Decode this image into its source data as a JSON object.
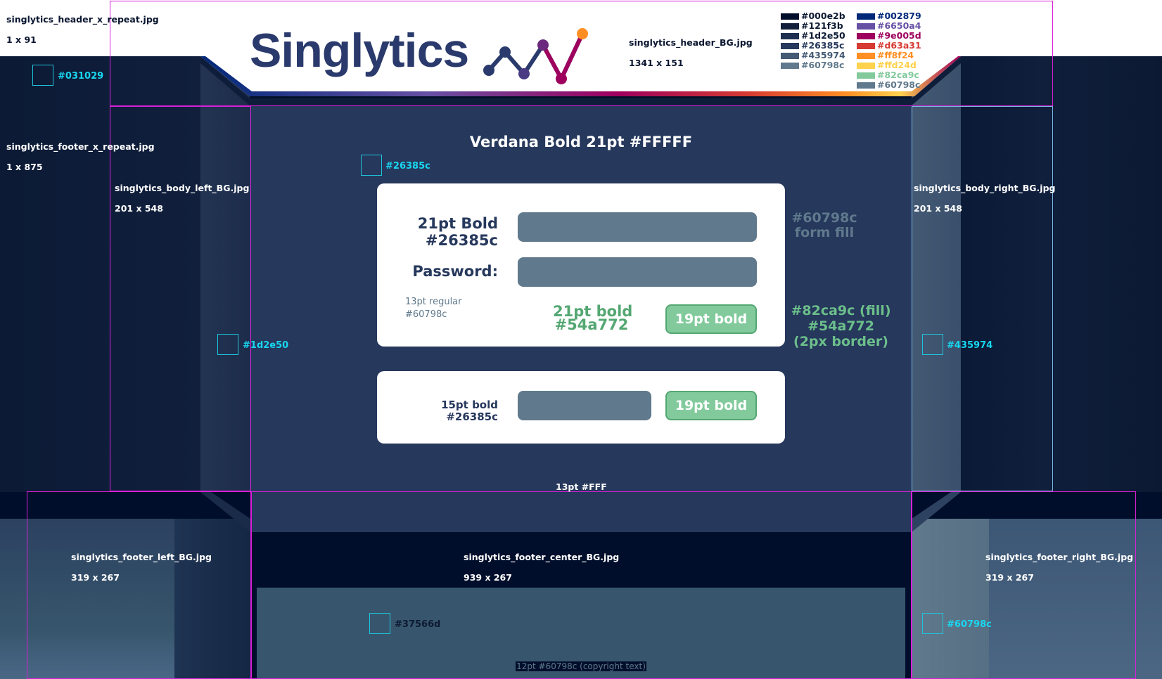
{
  "brand": {
    "logo_text": "Singlytics",
    "logo_mark": "line-chart-icon"
  },
  "annotations": {
    "header_x_repeat": {
      "file": "singlytics_header_x_repeat.jpg",
      "size": "1 x 91"
    },
    "header_bg": {
      "file": "singlytics_header_BG.jpg",
      "size": "1341 x 151"
    },
    "footer_x_repeat": {
      "file": "singlytics_footer_x_repeat.jpg",
      "size": "1 x 875"
    },
    "body_left_bg": {
      "file": "singlytics_body_left_BG.jpg",
      "size": "201 x 548"
    },
    "body_right_bg": {
      "file": "singlytics_body_right_BG.jpg",
      "size": "201 x 548"
    },
    "footer_left_bg": {
      "file": "singlytics_footer_left_BG.jpg",
      "size": "319 x 267"
    },
    "footer_center_bg": {
      "file": "singlytics_footer_center_BG.jpg",
      "size": "939 x 267"
    },
    "footer_right_bg": {
      "file": "singlytics_footer_right_BG.jpg",
      "size": "319 x 267"
    },
    "swatches": {
      "outer": "#031029",
      "body": "#26385c",
      "left_panel": "#1d2e50",
      "right_panel": "#435974",
      "footer_center": "#37566d",
      "footer_right": "#60798c"
    },
    "footer_text_note": "13pt #FFF"
  },
  "palette": {
    "left": [
      {
        "label": "#000e2b",
        "color": "#000e2b"
      },
      {
        "label": "#121f3b",
        "color": "#121f3b"
      },
      {
        "label": "#1d2e50",
        "color": "#1d2e50"
      },
      {
        "label": "#26385c",
        "color": "#26385c"
      },
      {
        "label": "#435974",
        "color": "#435974"
      },
      {
        "label": "#60798c",
        "color": "#60798c"
      }
    ],
    "right": [
      {
        "label": "#002879",
        "color": "#002879"
      },
      {
        "label": "#6650a4",
        "color": "#6650a4"
      },
      {
        "label": "#9e005d",
        "color": "#9e005d"
      },
      {
        "label": "#d63a31",
        "color": "#d63a31"
      },
      {
        "label": "#ff8f24",
        "color": "#ff8f24"
      },
      {
        "label": "#ffd24d",
        "color": "#ffd24d"
      },
      {
        "label": "#82ca9c",
        "color": "#82ca9c"
      },
      {
        "label": "#60798c",
        "color": "#60798c"
      }
    ]
  },
  "content": {
    "title": "Verdana Bold 21pt #FFFFF",
    "login": {
      "username_label_line1": "21pt Bold",
      "username_label_line2": "#26385c",
      "password_label": "Password:",
      "helper_line1": "13pt regular",
      "helper_line2": "#60798c",
      "link_line1": "21pt bold",
      "link_line2": "#54a772",
      "button_label": "19pt bold"
    },
    "secondary": {
      "label_line1": "15pt bold",
      "label_line2": "#26385c",
      "button_label": "19pt bold"
    },
    "fill_note_line1": "#60798c",
    "fill_note_line2": "form fill",
    "button_note_line1": "#82ca9c (fill)",
    "button_note_line2": "#54a772",
    "button_note_line3": "(2px border)",
    "copyright": "12pt #60798c (copyright text)"
  },
  "colors": {
    "field_fill": "#60798c",
    "button_fill": "#82ca9c",
    "button_border": "#54a772",
    "label": "#26385c",
    "accent_cyan": "#19d6f0",
    "guide_magenta": "#d91fd8"
  }
}
